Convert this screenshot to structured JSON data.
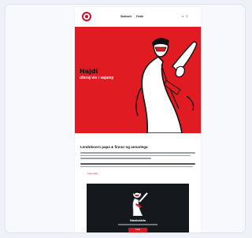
{
  "header": {
    "logo_text": "",
    "nav": [
      "Stofnanir",
      "Fréttir"
    ],
    "icons": [
      "search-icon",
      "menu-icon"
    ]
  },
  "hero": {
    "title": "Hajdi",
    "subtitle": "oferuj vie i vajamy",
    "background_color": "#e11b22"
  },
  "intro": {
    "title": "Lendokoorn papa & finnur og annarlega",
    "more_link": "Lesa meira"
  },
  "dark_card": {
    "title": "Hakakuldeta",
    "button": "Lesa"
  },
  "colors": {
    "accent": "#e11b22",
    "dark": "#15191d"
  }
}
